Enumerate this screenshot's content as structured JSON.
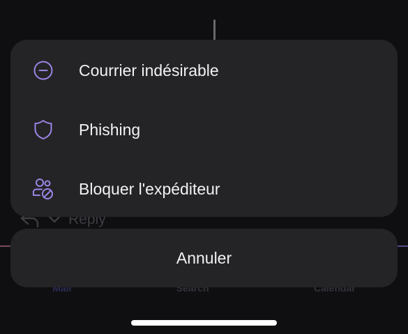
{
  "background": {
    "reply_label": "Reply",
    "tabs": [
      "Mail",
      "Search",
      "Calendar"
    ]
  },
  "sheet": {
    "accent_color": "#9b85e6",
    "items": [
      {
        "label": "Courrier indésirable",
        "icon": "minus-circle-icon"
      },
      {
        "label": "Phishing",
        "icon": "shield-icon"
      },
      {
        "label": "Bloquer l'expéditeur",
        "icon": "people-blocked-icon"
      }
    ],
    "cancel_label": "Annuler"
  }
}
